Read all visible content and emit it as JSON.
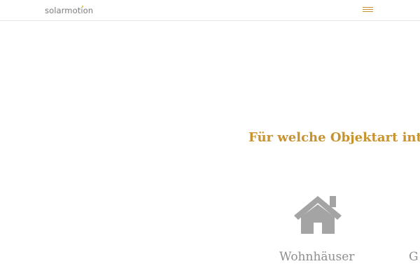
{
  "header": {
    "logo_text": "solarmotion",
    "menu_icon": "hamburger-menu-icon"
  },
  "colors": {
    "accent": "#c8922e",
    "logo_dot": "#f2b200",
    "icon_gray": "#a4a4a4",
    "label_gray": "#8e8e8e"
  },
  "main": {
    "question": "Für welche Objektart inte",
    "options": [
      {
        "label": "Wohnhäuser",
        "icon": "house-icon"
      },
      {
        "label": "G",
        "icon": ""
      }
    ]
  }
}
